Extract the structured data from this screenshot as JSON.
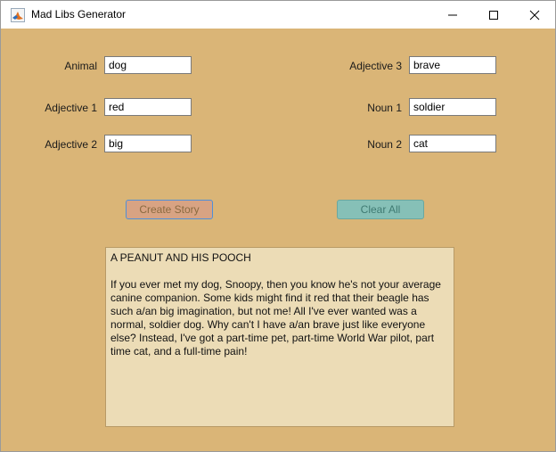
{
  "window": {
    "title": "Mad Libs Generator",
    "icon": "matlab-icon",
    "controls": [
      "minimize-icon",
      "maximize-icon",
      "close-icon"
    ]
  },
  "left_fields": [
    {
      "label": "Animal",
      "value": "dog"
    },
    {
      "label": "Adjective 1",
      "value": "red"
    },
    {
      "label": "Adjective 2",
      "value": "big"
    }
  ],
  "right_fields": [
    {
      "label": "Adjective 3",
      "value": "brave"
    },
    {
      "label": "Noun 1",
      "value": "soldier"
    },
    {
      "label": "Noun 2",
      "value": "cat"
    }
  ],
  "buttons": {
    "create_label": "Create Story",
    "clear_label": "Clear All"
  },
  "story": {
    "text": "A PEANUT AND HIS POOCH\n\nIf you ever met my dog, Snoopy, then you know he's not your average canine companion. Some kids might find it red that their beagle has such a/an big imagination, but not me! All I've ever wanted was a normal, soldier dog. Why can't I have a/an brave just like everyone else? Instead, I've got a part-time pet, part-time World War pilot, part time cat, and a full-time pain!"
  },
  "colors": {
    "background": "#dab577",
    "create_button": "#d8a383",
    "clear_button": "#86c0b7",
    "story_area": "#ecdcb6"
  }
}
